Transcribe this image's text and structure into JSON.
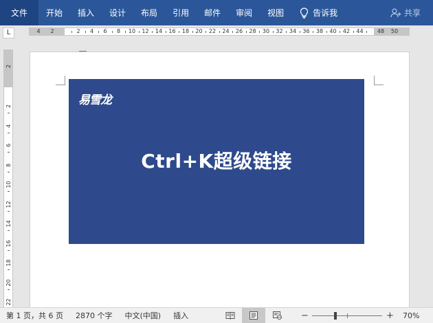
{
  "ribbon": {
    "tabs": [
      "文件",
      "开始",
      "插入",
      "设计",
      "布局",
      "引用",
      "邮件",
      "审阅",
      "视图"
    ],
    "tell_me": "告诉我",
    "share": "共享"
  },
  "ruler": {
    "corner": "L",
    "h_labels_left": [
      "4",
      "2"
    ],
    "h_labels": [
      "2",
      "4",
      "6",
      "8",
      "10",
      "12",
      "14",
      "16",
      "18",
      "20",
      "22",
      "24",
      "26",
      "28",
      "30",
      "32",
      "34",
      "36",
      "38",
      "40",
      "42",
      "44"
    ],
    "h_labels_right": [
      "48",
      "50"
    ],
    "v_labels_top": [
      "2"
    ],
    "v_labels": [
      "2",
      "4",
      "6",
      "8",
      "10",
      "12",
      "14",
      "16",
      "18",
      "20",
      "22"
    ]
  },
  "document": {
    "banner_logo": "易雪龙",
    "banner_headline": "Ctrl+K超级链接",
    "banner_color": "#2e4a8c"
  },
  "status": {
    "page": "第 1 页，共 6 页",
    "words": "2870 个字",
    "language": "中文(中国)",
    "mode": "插入",
    "zoom_minus": "−",
    "zoom_plus": "+",
    "zoom": "70%",
    "zoom_value": 70
  },
  "colors": {
    "ribbon": "#2b579a",
    "file_tab": "#1e4482"
  }
}
